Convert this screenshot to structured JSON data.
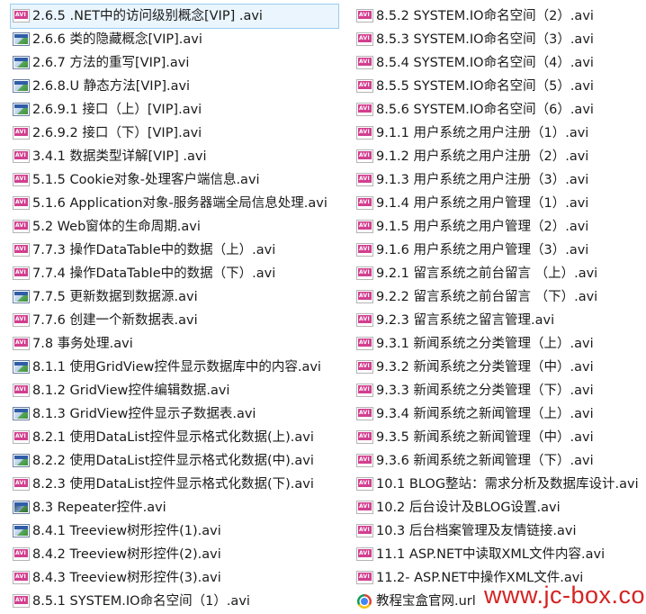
{
  "left_files": [
    {
      "name": "2.6.5 .NET中的访问级别概念[VIP] .avi",
      "icon": "avi-file-icon",
      "selected": true
    },
    {
      "name": "2.6.6 类的隐藏概念[VIP].avi",
      "icon": "video-thumbnail-icon"
    },
    {
      "name": "2.6.7 方法的重写[VIP].avi",
      "icon": "video-thumbnail-icon"
    },
    {
      "name": "2.6.8.U 静态方法[VIP].avi",
      "icon": "video-thumbnail-icon"
    },
    {
      "name": "2.6.9.1 接口（上）[VIP].avi",
      "icon": "video-thumbnail-icon"
    },
    {
      "name": "2.6.9.2 接口（下）[VIP].avi",
      "icon": "avi-file-icon"
    },
    {
      "name": "3.4.1 数据类型详解[VIP] .avi",
      "icon": "avi-file-icon"
    },
    {
      "name": "5.1.5 Cookie对象-处理客户端信息.avi",
      "icon": "avi-file-icon"
    },
    {
      "name": "5.1.6 Application对象-服务器端全局信息处理.avi",
      "icon": "avi-file-icon"
    },
    {
      "name": "5.2 Web窗体的生命周期.avi",
      "icon": "avi-file-icon"
    },
    {
      "name": "7.7.3 操作DataTable中的数据（上）.avi",
      "icon": "avi-file-icon"
    },
    {
      "name": "7.7.4 操作DataTable中的数据（下）.avi",
      "icon": "avi-file-icon"
    },
    {
      "name": "7.7.5 更新数据到数据源.avi",
      "icon": "video-thumbnail-icon"
    },
    {
      "name": "7.7.6 创建一个新数据表.avi",
      "icon": "avi-file-icon"
    },
    {
      "name": "7.8 事务处理.avi",
      "icon": "avi-file-icon"
    },
    {
      "name": "8.1.1 使用GridView控件显示数据库中的内容.avi",
      "icon": "video-thumbnail-icon"
    },
    {
      "name": "8.1.2 GridView控件编辑数据.avi",
      "icon": "avi-file-icon"
    },
    {
      "name": "8.1.3 GridView控件显示子数据表.avi",
      "icon": "video-thumbnail-icon"
    },
    {
      "name": "8.2.1 使用DataList控件显示格式化数据(上).avi",
      "icon": "avi-file-icon"
    },
    {
      "name": "8.2.2 使用DataList控件显示格式化数据(中).avi",
      "icon": "video-thumbnail-icon"
    },
    {
      "name": "8.2.3 使用DataList控件显示格式化数据(下).avi",
      "icon": "avi-file-icon"
    },
    {
      "name": "8.3 Repeater控件.avi",
      "icon": "video-thumbnail-dark-icon"
    },
    {
      "name": "8.4.1 Treeview树形控件(1).avi",
      "icon": "video-thumbnail-icon"
    },
    {
      "name": "8.4.2 Treeview树形控件(2).avi",
      "icon": "avi-file-icon"
    },
    {
      "name": "8.4.3 Treeview树形控件(3).avi",
      "icon": "avi-file-icon"
    },
    {
      "name": "8.5.1 SYSTEM.IO命名空间（1）.avi",
      "icon": "avi-file-icon"
    }
  ],
  "right_files": [
    {
      "name": "8.5.2 SYSTEM.IO命名空间（2）.avi",
      "icon": "avi-file-icon"
    },
    {
      "name": "8.5.3 SYSTEM.IO命名空间（3）.avi",
      "icon": "avi-file-icon"
    },
    {
      "name": "8.5.4 SYSTEM.IO命名空间（4）.avi",
      "icon": "avi-file-icon"
    },
    {
      "name": "8.5.5 SYSTEM.IO命名空间（5）.avi",
      "icon": "avi-file-icon"
    },
    {
      "name": "8.5.6 SYSTEM.IO命名空间（6）.avi",
      "icon": "avi-file-icon"
    },
    {
      "name": "9.1.1 用户系统之用户注册（1）.avi",
      "icon": "avi-file-icon"
    },
    {
      "name": "9.1.2 用户系统之用户注册（2）.avi",
      "icon": "avi-file-icon"
    },
    {
      "name": "9.1.3 用户系统之用户注册（3）.avi",
      "icon": "avi-file-icon"
    },
    {
      "name": "9.1.4 用户系统之用户管理（1）.avi",
      "icon": "avi-file-icon"
    },
    {
      "name": "9.1.5 用户系统之用户管理（2）.avi",
      "icon": "avi-file-icon"
    },
    {
      "name": "9.1.6 用户系统之用户管理（3）.avi",
      "icon": "avi-file-icon"
    },
    {
      "name": "9.2.1 留言系统之前台留言 （上）.avi",
      "icon": "avi-file-icon"
    },
    {
      "name": "9.2.2 留言系统之前台留言 （下）.avi",
      "icon": "avi-file-icon"
    },
    {
      "name": "9.2.3 留言系统之留言管理.avi",
      "icon": "avi-file-icon"
    },
    {
      "name": "9.3.1 新闻系统之分类管理（上）.avi",
      "icon": "avi-file-icon"
    },
    {
      "name": "9.3.2 新闻系统之分类管理（中）.avi",
      "icon": "avi-file-icon"
    },
    {
      "name": "9.3.3 新闻系统之分类管理（下）.avi",
      "icon": "avi-file-icon"
    },
    {
      "name": "9.3.4 新闻系统之新闻管理（上）.avi",
      "icon": "avi-file-icon"
    },
    {
      "name": "9.3.5 新闻系统之新闻管理（中）.avi",
      "icon": "avi-file-icon"
    },
    {
      "name": "9.3.6 新闻系统之新闻管理（下）.avi",
      "icon": "avi-file-icon"
    },
    {
      "name": "10.1 BLOG整站：需求分析及数据库设计.avi",
      "icon": "avi-file-icon"
    },
    {
      "name": "10.2 后台设计及BLOG设置.avi",
      "icon": "avi-file-icon"
    },
    {
      "name": "10.3 后台档案管理及友情链接.avi",
      "icon": "avi-file-icon"
    },
    {
      "name": "11.1 ASP.NET中读取XML文件内容.avi",
      "icon": "avi-file-icon"
    },
    {
      "name": "11.2- ASP.NET中操作XML文件.avi",
      "icon": "avi-file-icon"
    },
    {
      "name": "教程宝盒官网.url",
      "icon": "chrome-link-icon"
    }
  ],
  "watermark": "www.jc-box.com"
}
